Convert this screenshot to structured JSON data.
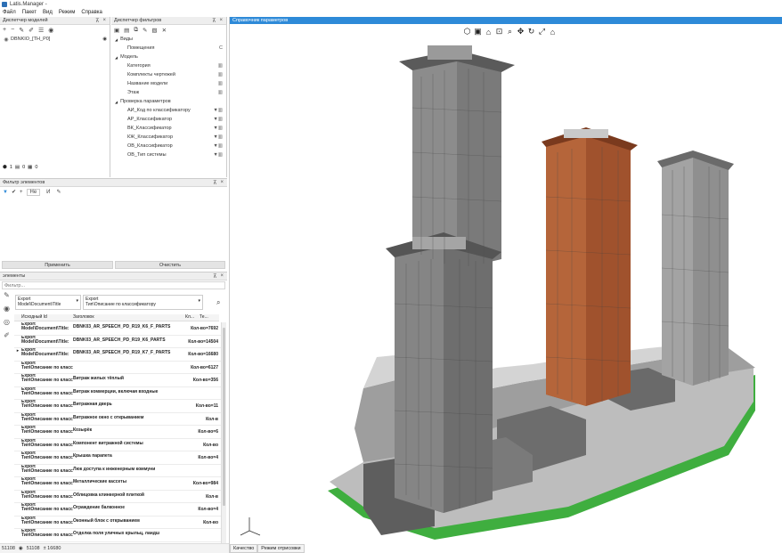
{
  "app": {
    "title": "Latis.Manager -"
  },
  "menu": [
    "Файл",
    "Пакет",
    "Вид",
    "Режим",
    "Справка"
  ],
  "models_panel": {
    "title": "Диспетчер моделей",
    "model_name": "DBNKIO_[TH_P0]",
    "footer": {
      "a": "1",
      "b": "0",
      "c": "0"
    }
  },
  "filters_panel": {
    "title": "Диспетчер фильтров",
    "groups": [
      {
        "label": "Виды",
        "items": [
          {
            "label": "Помещения",
            "tag": "C"
          }
        ]
      },
      {
        "label": "Модель",
        "items": [
          {
            "label": "Категория",
            "tag": "▥"
          },
          {
            "label": "Комплекты чертежей",
            "tag": "▥"
          },
          {
            "label": "Название модели",
            "tag": "▥"
          },
          {
            "label": "Этаж",
            "tag": "▥"
          }
        ]
      },
      {
        "label": "Проверка параметров",
        "items": [
          {
            "label": "АИ_Код по классификатору",
            "tag": "▼▥"
          },
          {
            "label": "АР_Классификатор",
            "tag": "▼▥"
          },
          {
            "label": "ВК_Классификатор",
            "tag": "▼▥"
          },
          {
            "label": "КЖ_Классификатор",
            "tag": "▼▥"
          },
          {
            "label": "ОВ_Классификатор",
            "tag": "▼▥"
          },
          {
            "label": "ОВ_Тип системы",
            "tag": "▼▥"
          }
        ]
      }
    ]
  },
  "elements_filter": {
    "title": "Фильтр элементов",
    "chips": [
      "Не",
      "И"
    ],
    "apply_label": "Применить",
    "clear_label": "Очистить"
  },
  "elements_panel": {
    "title": "элементы",
    "search_placeholder": "Фильтр...",
    "select1_line1": "Export",
    "select1_line2": "Model\\Document\\Title",
    "select2_line1": "Export",
    "select2_line2": "Тип\\Описание по классификатору",
    "columns": [
      "Исходный Id",
      "Заголовок",
      "Кл...",
      "Те..."
    ],
    "rows": [
      {
        "a": "Export",
        "b": "Model\\Document\\Title:",
        "title": "DBNK03_AR_SPEECH_PD_R19_K6_F_PARTS",
        "count": "Кол-во=7692",
        "marker": ""
      },
      {
        "a": "Export",
        "b": "Model\\Document\\Title:",
        "title": "DBNK03_AR_SPEECH_PD_R19_K6_PARTS",
        "count": "Кол-во=14504",
        "marker": ""
      },
      {
        "a": "Export",
        "b": "Model\\Document\\Title:",
        "title": "DBNK03_AR_SPEECH_PD_R19_K7_F_PARTS",
        "count": "Кол-во=16680",
        "marker": "▸"
      },
      {
        "a": "Export",
        "b": "Тип\\Описание по классификатору:",
        "title": "",
        "count": "Кол-во=6127",
        "marker": ""
      },
      {
        "a": "Export",
        "b": "Тип\\Описание по классификатору:",
        "title": "Витраж жилых тёплый",
        "count": "Кол-во=356",
        "marker": ""
      },
      {
        "a": "Export",
        "b": "Тип\\Описание по классификатору:",
        "title": "Витраж коммерции, включая входные",
        "count": "",
        "marker": ""
      },
      {
        "a": "Export",
        "b": "Тип\\Описание по классификатору:",
        "title": "Витражная дверь",
        "count": "Кол-во=11",
        "marker": ""
      },
      {
        "a": "Export",
        "b": "Тип\\Описание по классификатору:",
        "title": "Витражное окно с открыванием",
        "count": "Кол-в",
        "marker": ""
      },
      {
        "a": "Export",
        "b": "Тип\\Описание по классификатору:",
        "title": "Козырёк",
        "count": "Кол-во=6",
        "marker": ""
      },
      {
        "a": "Export",
        "b": "Тип\\Описание по классификатору:",
        "title": "Компонент витражной системы",
        "count": "Кол-во",
        "marker": ""
      },
      {
        "a": "Export",
        "b": "Тип\\Описание по классификатору:",
        "title": "Крышка парапета",
        "count": "Кол-во=4",
        "marker": ""
      },
      {
        "a": "Export",
        "b": "Тип\\Описание по классификатору:",
        "title": "Люк доступа к инженерным коммуни",
        "count": "",
        "marker": ""
      },
      {
        "a": "Export",
        "b": "Тип\\Описание по классификатору:",
        "title": "Металлические кассеты",
        "count": "Кол-во=984",
        "marker": ""
      },
      {
        "a": "Export",
        "b": "Тип\\Описание по классификатору:",
        "title": "Облицовка клинкерной плиткой",
        "count": "Кол-в",
        "marker": ""
      },
      {
        "a": "Export",
        "b": "Тип\\Описание по классификатору:",
        "title": "Ограждение балконное",
        "count": "Кол-во=4",
        "marker": ""
      },
      {
        "a": "Export",
        "b": "Тип\\Описание по классификатору:",
        "title": "Оконный блок с открыванием",
        "count": "Кол-во",
        "marker": ""
      },
      {
        "a": "Export",
        "b": "Тип\\Описание по классификатору:",
        "title": "Отделка поля уличных крыльц, ландш",
        "count": "",
        "marker": ""
      }
    ]
  },
  "status": {
    "s1": "51108",
    "s2": "51108",
    "s3": "± 16680"
  },
  "viewport": {
    "title": "Справочник параметров",
    "tabs": [
      "Качество",
      "Режим отрисовки"
    ]
  },
  "colors": {
    "accent": "#2e8ad8",
    "tower_gray": "#6b6b6b",
    "tower_brick": "#a0522d",
    "green_base": "#3fae3f"
  }
}
